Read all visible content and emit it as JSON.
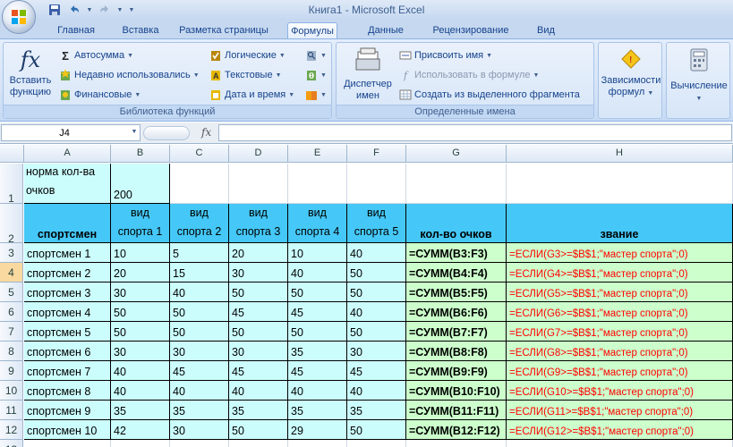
{
  "window": {
    "title": "Книга1 - Microsoft Excel"
  },
  "tabs": [
    "Главная",
    "Вставка",
    "Разметка страницы",
    "Формулы",
    "Данные",
    "Рецензирование",
    "Вид"
  ],
  "active_tab": "Формулы",
  "ribbon": {
    "function_library": {
      "label": "Библиотека функций",
      "insert_function_line1": "Вставить",
      "insert_function_line2": "функцию",
      "autosum": "Автосумма",
      "recent": "Недавно использовались",
      "financial": "Финансовые",
      "logical": "Логические",
      "text": "Текстовые",
      "datetime": "Дата и время"
    },
    "defined_names": {
      "label": "Определенные имена",
      "manager_line1": "Диспетчер",
      "manager_line2": "имен",
      "define_name": "Присвоить имя",
      "use_in_formula": "Использовать в формуле",
      "create_from_selection": "Создать из выделенного фрагмента"
    },
    "dependencies_line1": "Зависимости",
    "dependencies_line2": "формул",
    "calculation": "Вычисление"
  },
  "formula_bar": {
    "name_box": "J4",
    "fx": "fx",
    "formula": ""
  },
  "columns": [
    "A",
    "B",
    "C",
    "D",
    "E",
    "F",
    "G",
    "H"
  ],
  "rows": [
    "1",
    "2",
    "3",
    "4",
    "5",
    "6",
    "7",
    "8",
    "9",
    "10",
    "11",
    "12",
    "13"
  ],
  "sheet": {
    "a1_line1": "норма кол-ва",
    "a1_line2": "очков",
    "b1": "200",
    "a2": "спортсмен",
    "sport_line1": "вид",
    "sport_headers": [
      "спорта 1",
      "спорта 2",
      "спорта 3",
      "спорта 4",
      "спорта 5"
    ],
    "g2": "кол-во очков",
    "h2": "звание",
    "data": [
      {
        "name": "спортсмен 1",
        "v": [
          "10",
          "5",
          "20",
          "10",
          "40"
        ],
        "sum": "=СУММ(B3:F3)",
        "rank": "=ЕСЛИ(G3>=$B$1;\"мастер спорта\";0)"
      },
      {
        "name": "спортсмен 2",
        "v": [
          "20",
          "15",
          "30",
          "40",
          "50"
        ],
        "sum": "=СУММ(B4:F4)",
        "rank": "=ЕСЛИ(G4>=$B$1;\"мастер спорта\";0)"
      },
      {
        "name": "спортсмен 3",
        "v": [
          "30",
          "40",
          "50",
          "50",
          "50"
        ],
        "sum": "=СУММ(B5:F5)",
        "rank": "=ЕСЛИ(G5>=$B$1;\"мастер спорта\";0)"
      },
      {
        "name": "спортсмен 4",
        "v": [
          "50",
          "50",
          "45",
          "45",
          "40"
        ],
        "sum": "=СУММ(B6:F6)",
        "rank": "=ЕСЛИ(G6>=$B$1;\"мастер спорта\";0)"
      },
      {
        "name": "спортсмен 5",
        "v": [
          "50",
          "50",
          "50",
          "50",
          "50"
        ],
        "sum": "=СУММ(B7:F7)",
        "rank": "=ЕСЛИ(G7>=$B$1;\"мастер спорта\";0)"
      },
      {
        "name": "спортсмен 6",
        "v": [
          "30",
          "30",
          "30",
          "35",
          "30"
        ],
        "sum": "=СУММ(B8:F8)",
        "rank": "=ЕСЛИ(G8>=$B$1;\"мастер спорта\";0)"
      },
      {
        "name": "спортсмен 7",
        "v": [
          "40",
          "45",
          "45",
          "45",
          "45"
        ],
        "sum": "=СУММ(B9:F9)",
        "rank": "=ЕСЛИ(G9>=$B$1;\"мастер спорта\";0)"
      },
      {
        "name": "спортсмен 8",
        "v": [
          "40",
          "40",
          "40",
          "40",
          "40"
        ],
        "sum": "=СУММ(B10:F10)",
        "rank": "=ЕСЛИ(G10>=$B$1;\"мастер спорта\";0)"
      },
      {
        "name": "спортсмен 9",
        "v": [
          "35",
          "35",
          "35",
          "35",
          "35"
        ],
        "sum": "=СУММ(B11:F11)",
        "rank": "=ЕСЛИ(G11>=$B$1;\"мастер спорта\";0)"
      },
      {
        "name": "спортсмен 10",
        "v": [
          "42",
          "30",
          "50",
          "29",
          "50"
        ],
        "sum": "=СУММ(B12:F12)",
        "rank": "=ЕСЛИ(G12>=$B$1;\"мастер спорта\";0)"
      }
    ]
  },
  "colors": {
    "header_blue": "#45c8f7",
    "cyan_fill": "#ccfdfd",
    "green_fill": "#ccffcc",
    "formula_red": "#ff0000"
  }
}
